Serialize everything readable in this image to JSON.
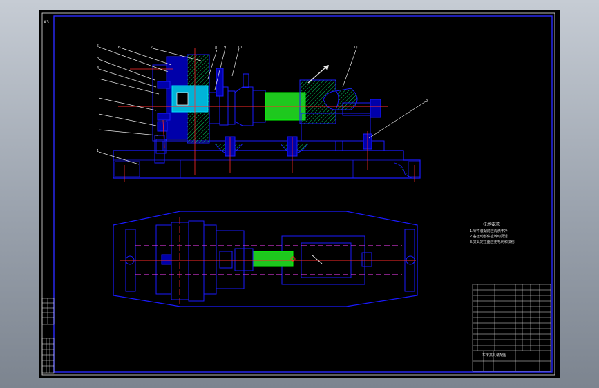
{
  "drawing": {
    "balloons": [
      "5",
      "6",
      "7",
      "8",
      "9",
      "10",
      "11",
      "3",
      "4",
      "1",
      "2"
    ],
    "frame_tag": "A3",
    "tech_notes": {
      "title": "技术要求",
      "lines": [
        "1.零件装配前应清洗干净",
        "2.各运动部件应转动灵活",
        "3.夹具定位面应无毛刺和损伤"
      ]
    },
    "title_block": {
      "drawing_title": "车床夹具装配图"
    }
  },
  "colors": {
    "outline": "#1a1aff",
    "part_fill": "#0000cc",
    "cyan": "#00c8e6",
    "hatch": "#00d060",
    "green_part": "#00e000",
    "centerline": "#ff2a2a",
    "hidden": "#ff40ff",
    "leader": "#e6e6e6",
    "text": "#e6e6e6"
  }
}
